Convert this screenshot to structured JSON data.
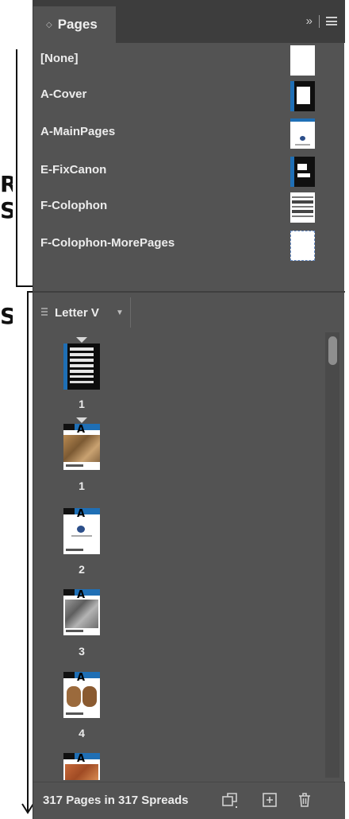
{
  "annotations": {
    "letters": [
      "R",
      "S",
      "S"
    ]
  },
  "panel": {
    "tab_label": "Pages",
    "collapse_glyph": "»"
  },
  "masters": [
    {
      "name": "[None]",
      "thumb": "blank"
    },
    {
      "name": "A-Cover",
      "thumb": "cover"
    },
    {
      "name": "A-MainPages",
      "thumb": "main"
    },
    {
      "name": "E-FixCanon",
      "thumb": "fixcanon"
    },
    {
      "name": "F-Colophon",
      "thumb": "colophon"
    },
    {
      "name": "F-Colophon-MorePages",
      "thumb": "dotted"
    }
  ],
  "pages_header": {
    "size_label": "Letter V"
  },
  "pages": [
    {
      "number": "1",
      "master_letter": "",
      "style": "cover"
    },
    {
      "number": "1",
      "master_letter": "A",
      "style": "brown"
    },
    {
      "number": "2",
      "master_letter": "A",
      "style": "white"
    },
    {
      "number": "3",
      "master_letter": "A",
      "style": "gray"
    },
    {
      "number": "4",
      "master_letter": "A",
      "style": "tan"
    },
    {
      "number": "",
      "master_letter": "A",
      "style": "orange"
    }
  ],
  "footer": {
    "summary": "317 Pages in 317 Spreads"
  },
  "colors": {
    "panel_bg": "#535353",
    "tab_bar_bg": "#3d3d3d",
    "accent_blue": "#1f6fb5"
  }
}
